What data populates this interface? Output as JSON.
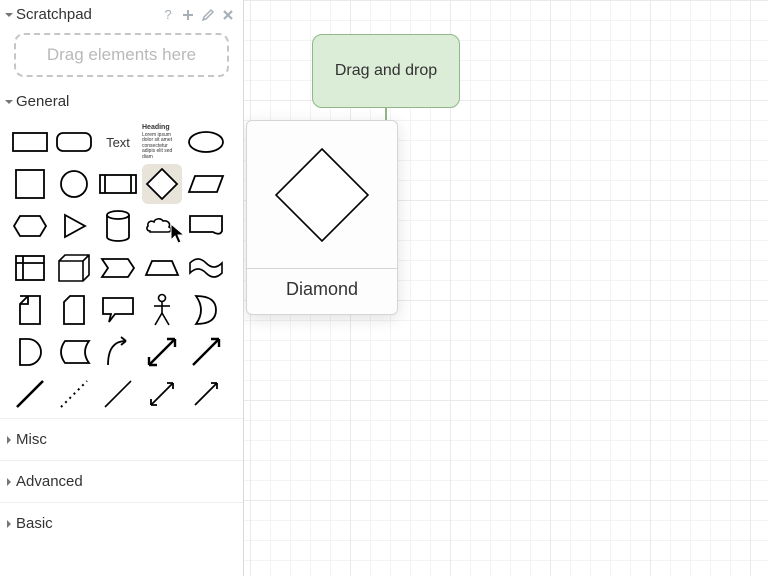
{
  "scratchpad": {
    "title": "Scratchpad",
    "placeholder": "Drag elements here"
  },
  "sections": {
    "general": "General",
    "misc": "Misc",
    "advanced": "Advanced",
    "basic": "Basic"
  },
  "palette": {
    "text_label": "Text",
    "heading_label": "Heading",
    "heading_body": "Lorem ipsum dolor sit amet consectetur adipis elit sed diam"
  },
  "canvas": {
    "node_label": "Drag and drop"
  },
  "preview": {
    "caption": "Diamond"
  }
}
